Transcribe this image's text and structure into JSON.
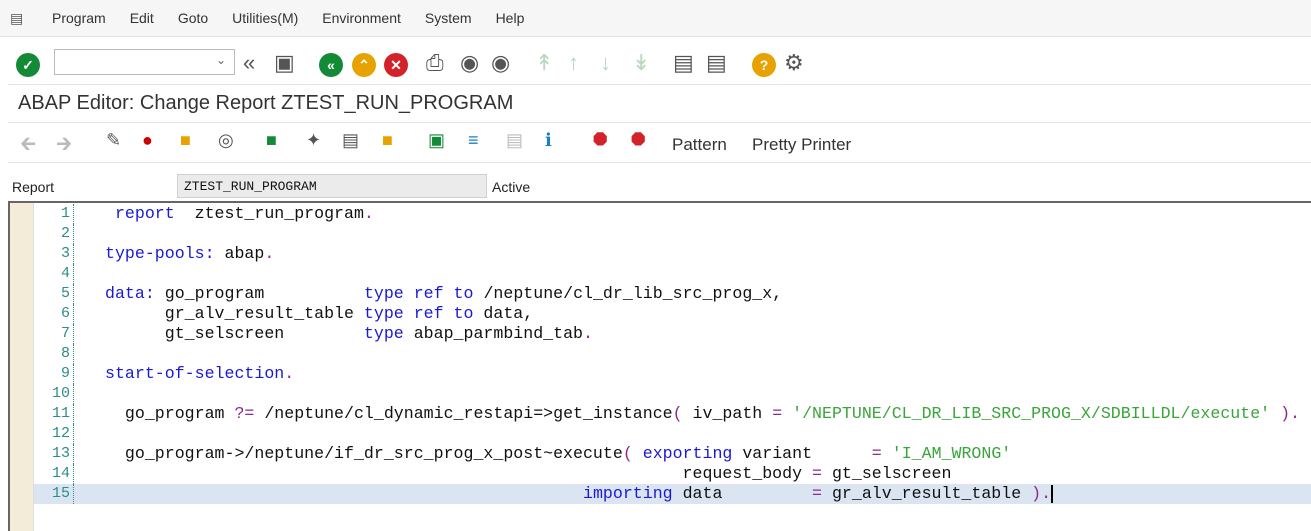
{
  "menu": [
    "Program",
    "Edit",
    "Goto",
    "Utilities(M)",
    "Environment",
    "System",
    "Help"
  ],
  "title": "ABAP Editor: Change Report ZTEST_RUN_PROGRAM",
  "toolbar_text": {
    "pattern": "Pattern",
    "pretty_printer": "Pretty Printer"
  },
  "header": {
    "label": "Report",
    "value": "ZTEST_RUN_PROGRAM",
    "status": "Active"
  },
  "colors": {
    "keyword": "#1a1ad4",
    "string": "#3aa53a",
    "operator": "#8a2a8a",
    "line_number": "#2d8c8c",
    "current_line": "#dbe5f1"
  },
  "code": [
    {
      "n": "1",
      "t": [
        [
          " report",
          "kw"
        ],
        [
          "  ztest_run_program",
          ""
        ],
        [
          ".",
          "op"
        ]
      ]
    },
    {
      "n": "2",
      "t": []
    },
    {
      "n": "3",
      "t": [
        [
          "type-pools",
          "kw"
        ],
        [
          ":",
          "kw"
        ],
        [
          " abap",
          ""
        ],
        [
          ".",
          "op"
        ]
      ]
    },
    {
      "n": "4",
      "t": []
    },
    {
      "n": "5",
      "t": [
        [
          "data",
          "kw"
        ],
        [
          ":",
          "kw"
        ],
        [
          " go_program          ",
          ""
        ],
        [
          "type ref to",
          "kw"
        ],
        [
          " /neptune/cl_dr_lib_src_prog_x,",
          ""
        ]
      ]
    },
    {
      "n": "6",
      "t": [
        [
          "      gr_alv_result_table ",
          ""
        ],
        [
          "type ref to",
          "kw"
        ],
        [
          " data,",
          ""
        ]
      ]
    },
    {
      "n": "7",
      "t": [
        [
          "      gt_selscreen        ",
          ""
        ],
        [
          "type",
          "kw"
        ],
        [
          " abap_parmbind_tab",
          ""
        ],
        [
          ".",
          "op"
        ]
      ]
    },
    {
      "n": "8",
      "t": []
    },
    {
      "n": "9",
      "t": [
        [
          "start-of-selection",
          "kw"
        ],
        [
          ".",
          "op"
        ]
      ]
    },
    {
      "n": "10",
      "t": []
    },
    {
      "n": "11",
      "t": [
        [
          "  go_program ",
          ""
        ],
        [
          "?=",
          "op"
        ],
        [
          " /neptune/cl_dynamic_restapi=>get_instance",
          ""
        ],
        [
          "(",
          "op"
        ],
        [
          " iv_path ",
          ""
        ],
        [
          "=",
          "op"
        ],
        [
          " ",
          ""
        ],
        [
          "'/NEPTUNE/CL_DR_LIB_SRC_PROG_X/SDBILLDL/execute'",
          "str"
        ],
        [
          " ",
          ""
        ],
        [
          ").",
          "op"
        ]
      ]
    },
    {
      "n": "12",
      "t": []
    },
    {
      "n": "13",
      "t": [
        [
          "  go_program->/neptune/if_dr_src_prog_x_post~execute",
          ""
        ],
        [
          "(",
          "op"
        ],
        [
          " ",
          ""
        ],
        [
          "exporting",
          "kw"
        ],
        [
          " variant      ",
          ""
        ],
        [
          "=",
          "op"
        ],
        [
          " ",
          ""
        ],
        [
          "'I_AM_WRONG'",
          "str"
        ]
      ]
    },
    {
      "n": "14",
      "t": [
        [
          "                                                          request_body ",
          ""
        ],
        [
          "=",
          "op"
        ],
        [
          " gt_selscreen",
          ""
        ]
      ]
    },
    {
      "n": "15",
      "t": [
        [
          "                                                ",
          ""
        ],
        [
          "importing",
          "kw"
        ],
        [
          " data         ",
          ""
        ],
        [
          "=",
          "op"
        ],
        [
          " gr_alv_result_table ",
          ""
        ],
        [
          ").",
          "op"
        ]
      ]
    }
  ]
}
